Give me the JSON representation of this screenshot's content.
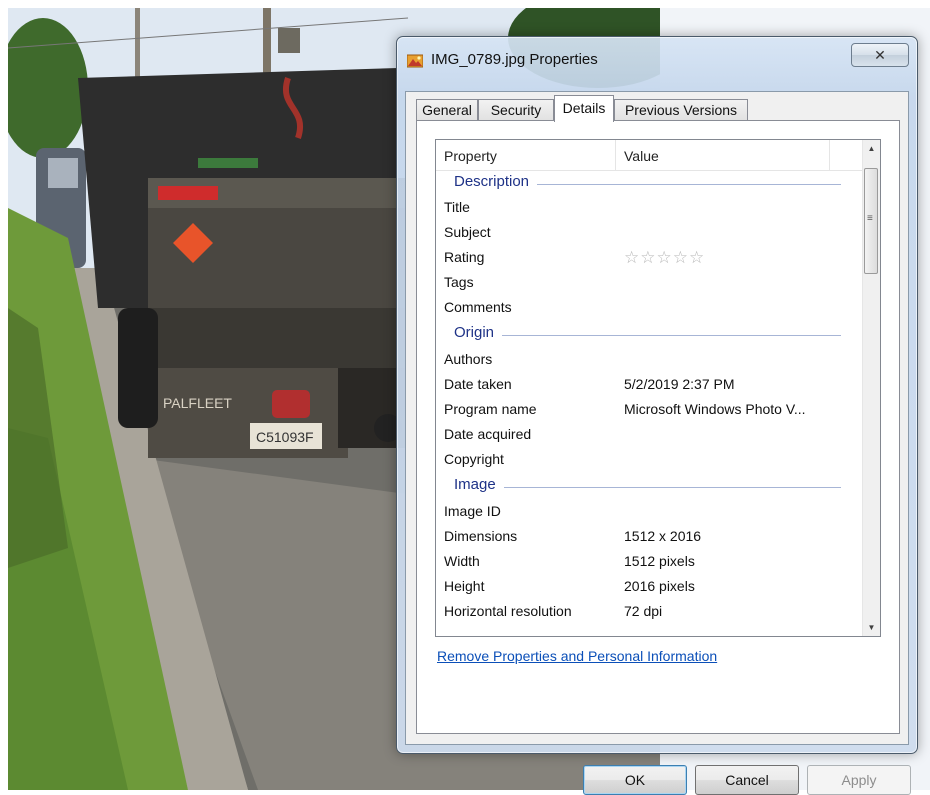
{
  "window": {
    "title": "IMG_0789.jpg Properties",
    "close_label": "✕"
  },
  "tabs": [
    "General",
    "Security",
    "Details",
    "Previous Versions"
  ],
  "active_tab": "Details",
  "list": {
    "columns": [
      "Property",
      "Value"
    ],
    "groups": [
      {
        "name": "Description",
        "rows": [
          {
            "property": "Title",
            "value": ""
          },
          {
            "property": "Subject",
            "value": ""
          },
          {
            "property": "Rating",
            "value": "",
            "rating_stars": 0,
            "rating_max": 5
          },
          {
            "property": "Tags",
            "value": ""
          },
          {
            "property": "Comments",
            "value": ""
          }
        ]
      },
      {
        "name": "Origin",
        "rows": [
          {
            "property": "Authors",
            "value": ""
          },
          {
            "property": "Date taken",
            "value": "5/2/2019 2:37 PM"
          },
          {
            "property": "Program name",
            "value": "Microsoft Windows Photo V..."
          },
          {
            "property": "Date acquired",
            "value": ""
          },
          {
            "property": "Copyright",
            "value": ""
          }
        ]
      },
      {
        "name": "Image",
        "rows": [
          {
            "property": "Image ID",
            "value": ""
          },
          {
            "property": "Dimensions",
            "value": "1512 x 2016"
          },
          {
            "property": "Width",
            "value": "1512 pixels"
          },
          {
            "property": "Height",
            "value": "2016 pixels"
          },
          {
            "property": "Horizontal resolution",
            "value": "72 dpi"
          }
        ]
      }
    ]
  },
  "remove_link": "Remove Properties and Personal Information",
  "buttons": {
    "ok": "OK",
    "cancel": "Cancel",
    "apply": "Apply"
  },
  "photo": {
    "brand_text": "PALFLEET",
    "plate_text": "C51093F"
  },
  "colors": {
    "group_header": "#1e3287",
    "link": "#0b4fb8",
    "window_frame": "#c4d6ec"
  }
}
